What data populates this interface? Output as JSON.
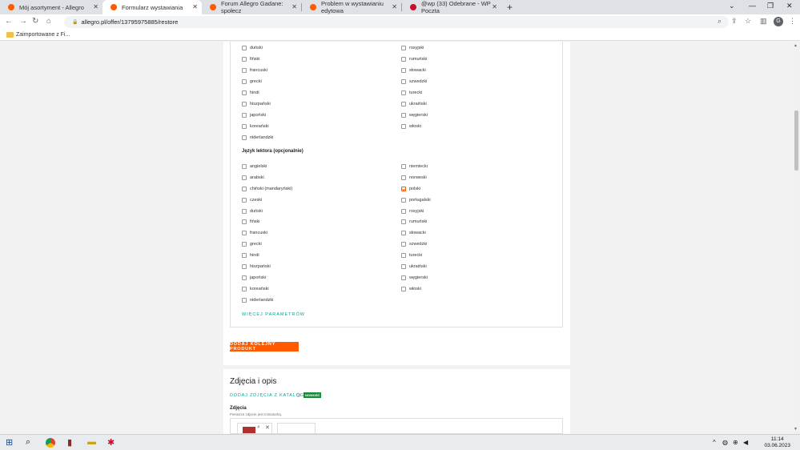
{
  "browser": {
    "tabs": [
      {
        "title": "Mój asortyment - Allegro",
        "color": "#ff5a00"
      },
      {
        "title": "Formularz wystawiania",
        "color": "#ff5a00"
      },
      {
        "title": "Forum Allegro Gadane: społecz",
        "color": "#ff5a00"
      },
      {
        "title": "Problem w wystawianiu edytowa",
        "color": "#ff5a00"
      },
      {
        "title": "@wp (33) Odebrane - WP Poczta",
        "color": "#c8102e"
      }
    ],
    "active_tab": 1,
    "url": "allegro.pl/offer/13795975885/restore",
    "bookmark": "Zaimportowane z Fi...",
    "avatar_letter": "G"
  },
  "languages_top": {
    "left": [
      "duński",
      "fiński",
      "francuski",
      "grecki",
      "hindi",
      "hiszpański",
      "japoński",
      "koreański",
      "niderlandzki"
    ],
    "right": [
      "rosyjski",
      "rumuński",
      "słowacki",
      "szwedzki",
      "turecki",
      "ukraiński",
      "węgierski",
      "włoski"
    ]
  },
  "lector": {
    "label": "Język lektora (opcjonalnie)",
    "left": [
      "angielski",
      "arabski",
      "chiński (mandaryński)",
      "czeski",
      "duński",
      "fiński",
      "francuski",
      "grecki",
      "hindi",
      "hiszpański",
      "japoński",
      "koreański",
      "niderlandzki"
    ],
    "right": [
      "niemiecki",
      "norweski",
      "polski",
      "portugalski",
      "rosyjski",
      "rumuński",
      "słowacki",
      "szwedzki",
      "turecki",
      "ukraiński",
      "węgierski",
      "włoski"
    ],
    "checked": "polski"
  },
  "more_params": "WIĘCEJ PARAMETRÓW",
  "add_product": "DODAJ KOLEJNY PRODUKT",
  "photos_section": {
    "title": "Zdjęcia i opis",
    "catalog_link": "DODAJ ZDJĘCIA Z KATALOGU",
    "new_badge": "NOWOŚĆ",
    "photos_label": "Zdjęcia",
    "photos_hint": "Pierwsze zdjęcie jest miniaturką."
  },
  "taskbar": {
    "time": "11:14",
    "date": "03.06.2023"
  }
}
